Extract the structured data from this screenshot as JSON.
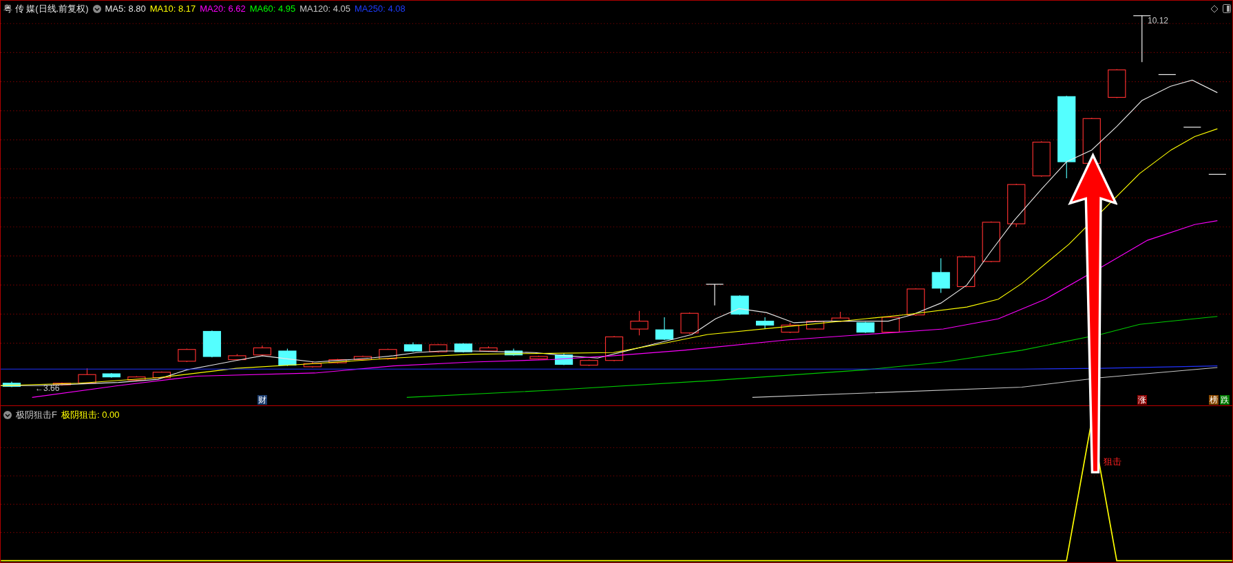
{
  "chart_header": {
    "title": "粤 传 媒(日线.前复权)",
    "indicators": [
      {
        "label": "MA5: 8.80",
        "color": "#e6e6e6"
      },
      {
        "label": "MA10: 8.17",
        "color": "#ffff00"
      },
      {
        "label": "MA20: 6.62",
        "color": "#ff00ff"
      },
      {
        "label": "MA60: 4.95",
        "color": "#00ff00"
      },
      {
        "label": "MA120: 4.05",
        "color": "#c8c8c8"
      },
      {
        "label": "MA250: 4.08",
        "color": "#1e3cff"
      }
    ]
  },
  "price_marks": {
    "high": "10.12",
    "low": "←3.66"
  },
  "event_tags": [
    {
      "label": "财",
      "color": "#1c3d6e"
    },
    {
      "label": "涨",
      "color": "#8b0000"
    },
    {
      "label": "榜",
      "color": "#8b4a00"
    },
    {
      "label": "跌",
      "color": "#007a00"
    }
  ],
  "indicator_panel": {
    "title": "极阴狙击F",
    "value": "极阴狙击: 0.00",
    "signal_label": "狙击"
  }
}
